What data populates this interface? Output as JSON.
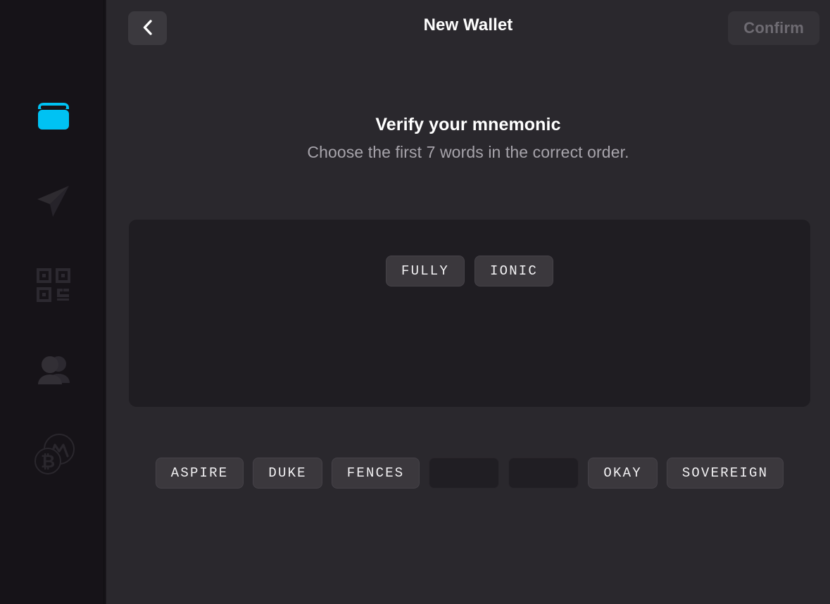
{
  "colors": {
    "page_bg": "#2a282d",
    "sidebar_bg": "#161318",
    "panel_bg": "#1f1d22",
    "chip_bg": "#3b383d",
    "chip_empty_bg": "#201e23",
    "accent": "#00c2f3",
    "title_text": "#fdfdfd",
    "subtitle_text": "#a7a4ab",
    "disabled_text": "#6e6b72"
  },
  "sidebar": {
    "items": [
      {
        "id": "wallet",
        "icon": "wallet-icon",
        "label": "Wallet",
        "active": true
      },
      {
        "id": "send",
        "icon": "paper-plane-icon",
        "label": "Send",
        "active": false
      },
      {
        "id": "receive",
        "icon": "qr-code-icon",
        "label": "Receive",
        "active": false
      },
      {
        "id": "contacts",
        "icon": "contacts-icon",
        "label": "Contacts",
        "active": false
      },
      {
        "id": "exchange",
        "icon": "coins-icon",
        "label": "Exchange",
        "active": false
      }
    ]
  },
  "topbar": {
    "back_icon": "chevron-left-icon",
    "back_label": "Back",
    "title": "New Wallet",
    "confirm_label": "Confirm",
    "confirm_enabled": false
  },
  "content": {
    "heading": "Verify your mnemonic",
    "subheading": "Choose the first 7 words in the correct order.",
    "required_word_count": 7
  },
  "selected_words": [
    {
      "index": 0,
      "text": "FULLY"
    },
    {
      "index": 1,
      "text": "IONIC"
    }
  ],
  "word_bank": [
    {
      "index": 0,
      "text": "ASPIRE",
      "empty": false
    },
    {
      "index": 1,
      "text": "DUKE",
      "empty": false
    },
    {
      "index": 2,
      "text": "FENCES",
      "empty": false
    },
    {
      "index": 3,
      "text": "",
      "empty": true
    },
    {
      "index": 4,
      "text": "",
      "empty": true
    },
    {
      "index": 5,
      "text": "OKAY",
      "empty": false
    },
    {
      "index": 6,
      "text": "SOVEREIGN",
      "empty": false
    }
  ]
}
